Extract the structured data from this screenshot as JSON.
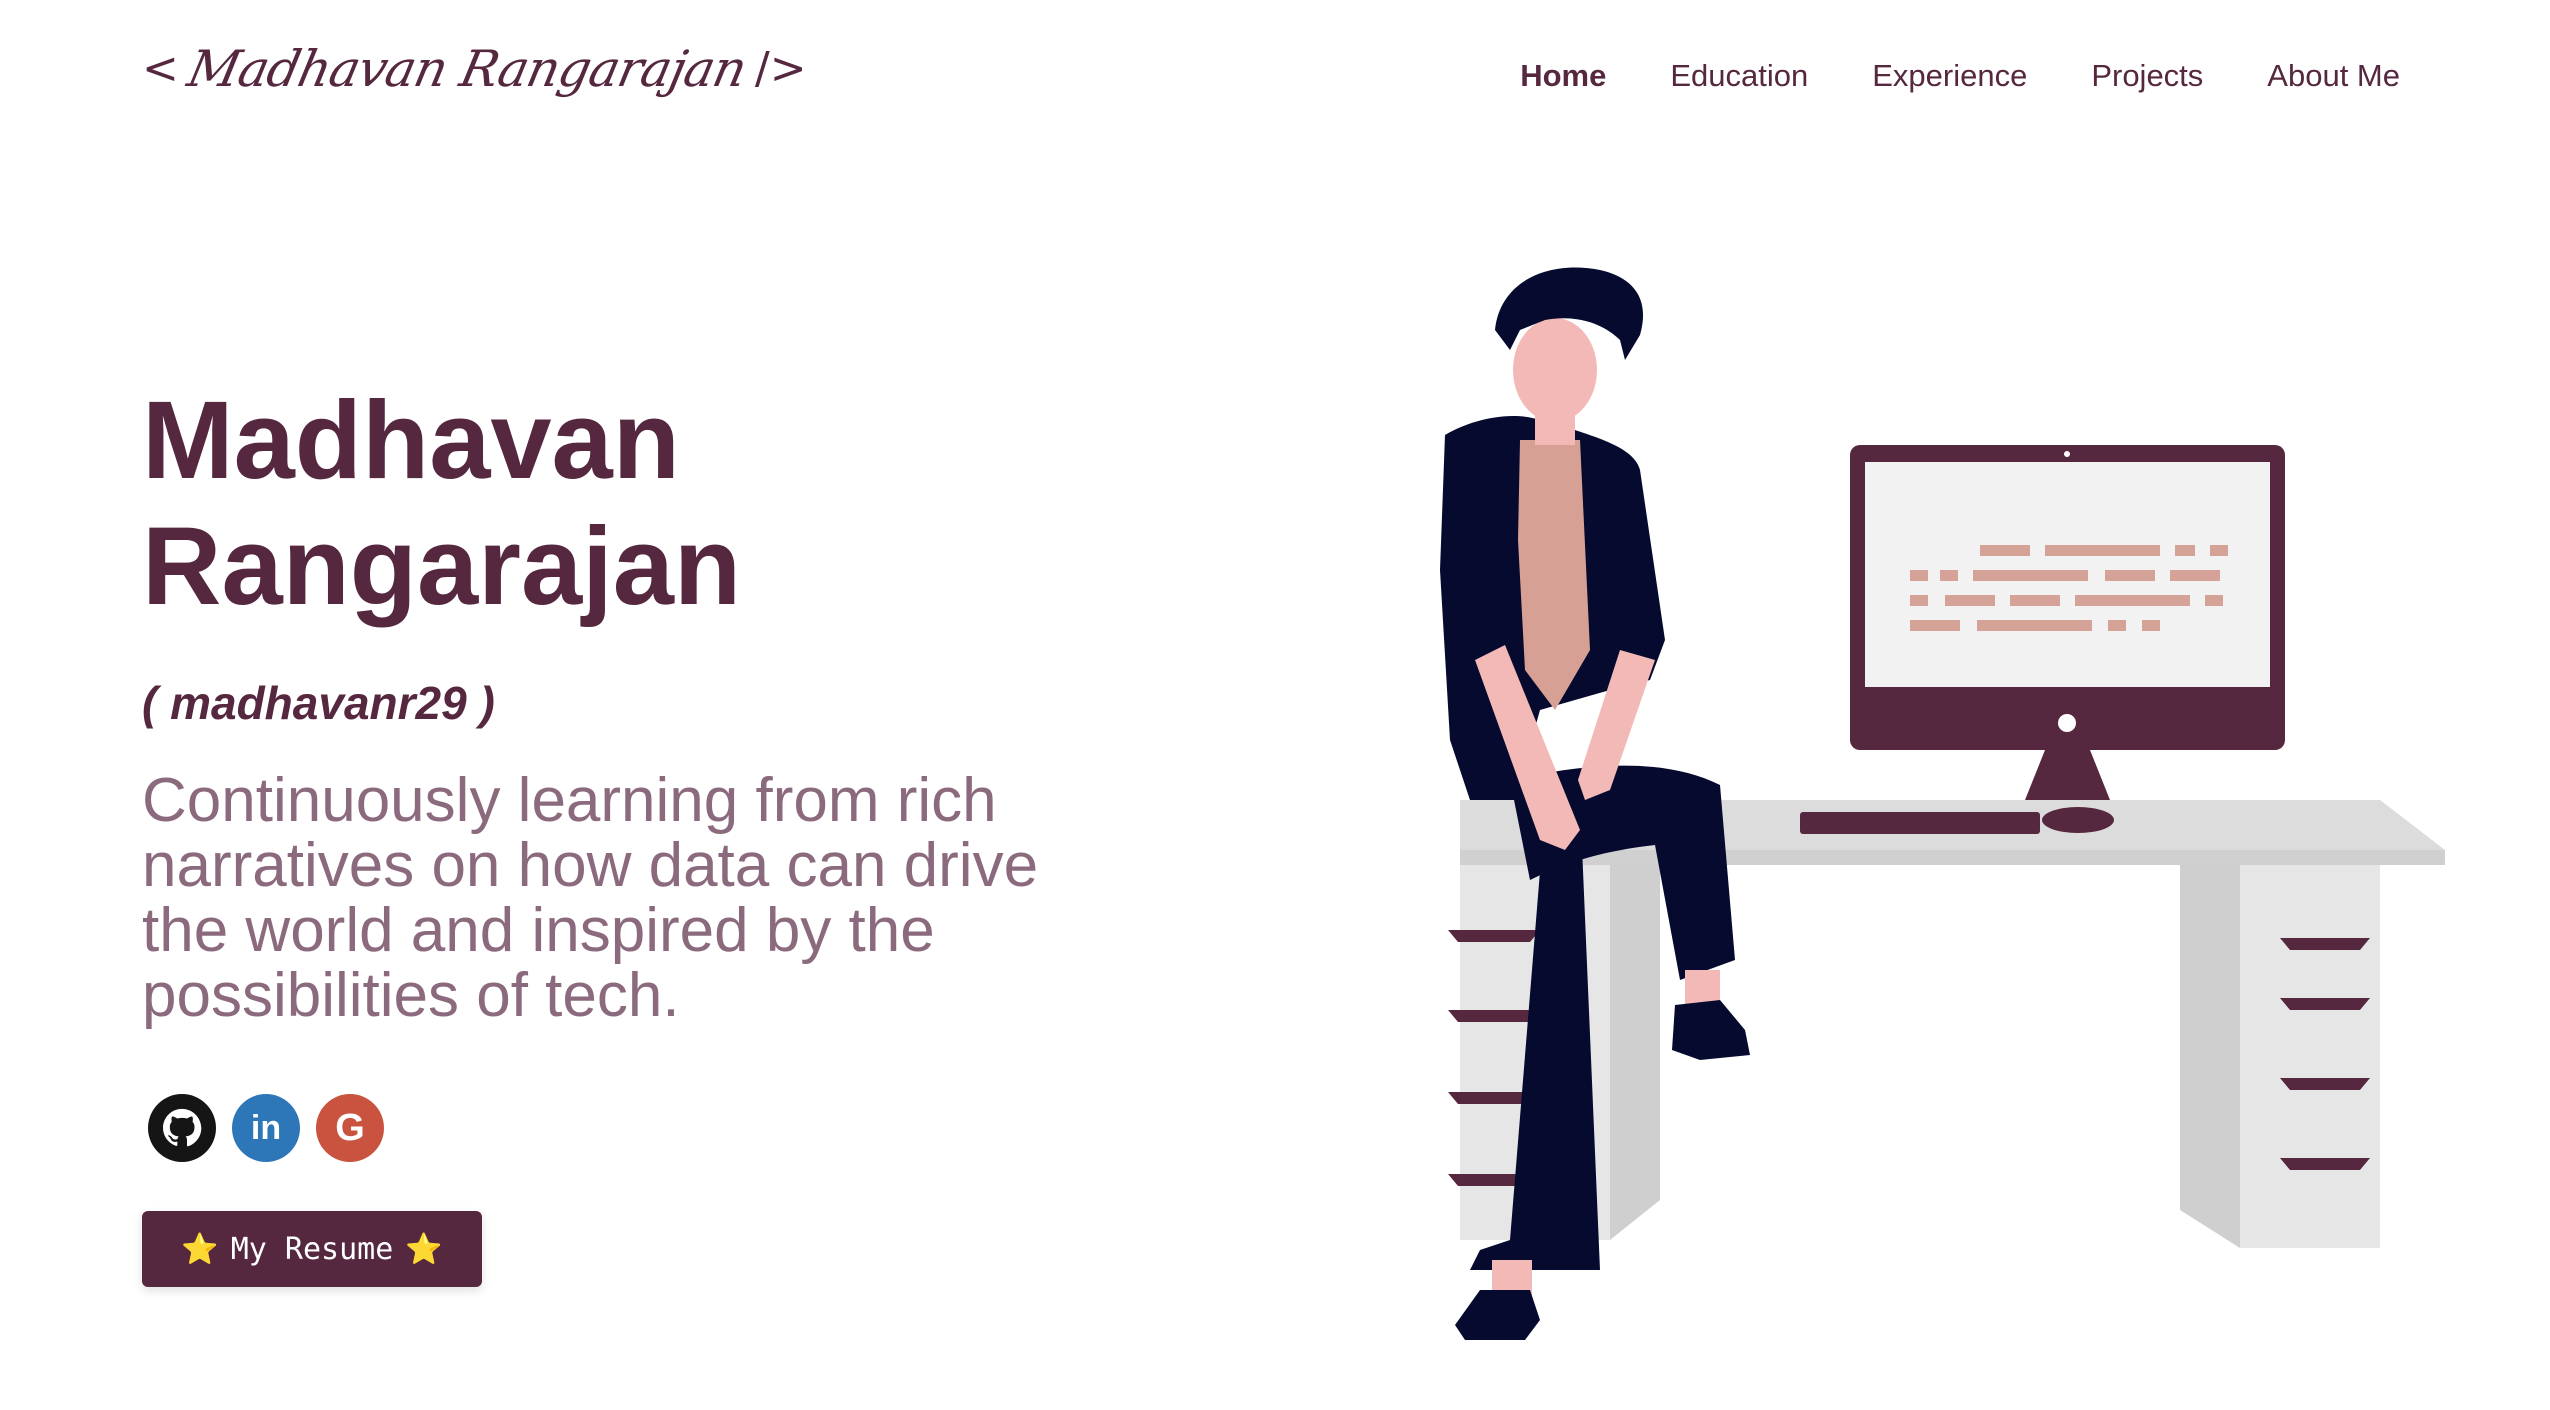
{
  "header": {
    "logo_open": "<",
    "logo_signature": "Madhavan Rangarajan",
    "logo_close": "/>",
    "nav": [
      {
        "label": "Home",
        "active": true
      },
      {
        "label": "Education",
        "active": false
      },
      {
        "label": "Experience",
        "active": false
      },
      {
        "label": "Projects",
        "active": false
      },
      {
        "label": "About Me",
        "active": false
      }
    ]
  },
  "hero": {
    "name_line1": "Madhavan",
    "name_line2": "Rangarajan",
    "handle": "( madhavanr29 )",
    "tagline_lines": [
      "Continuously learning from rich",
      "narratives on how data can drive",
      "the world and inspired by the",
      "possibilities of tech."
    ]
  },
  "socials": [
    {
      "name": "github",
      "icon": "github-icon",
      "color": "#151515"
    },
    {
      "name": "linkedin",
      "icon": "linkedin-icon",
      "label": "in",
      "color": "#2d77b8"
    },
    {
      "name": "google",
      "icon": "google-icon",
      "label": "G",
      "color": "#c9533f"
    }
  ],
  "resume_button": {
    "label": "My Resume",
    "star": "⭐"
  },
  "colors": {
    "primary": "#55283f",
    "tagline": "#8b6a7e",
    "accent_star": "#f6c344"
  }
}
